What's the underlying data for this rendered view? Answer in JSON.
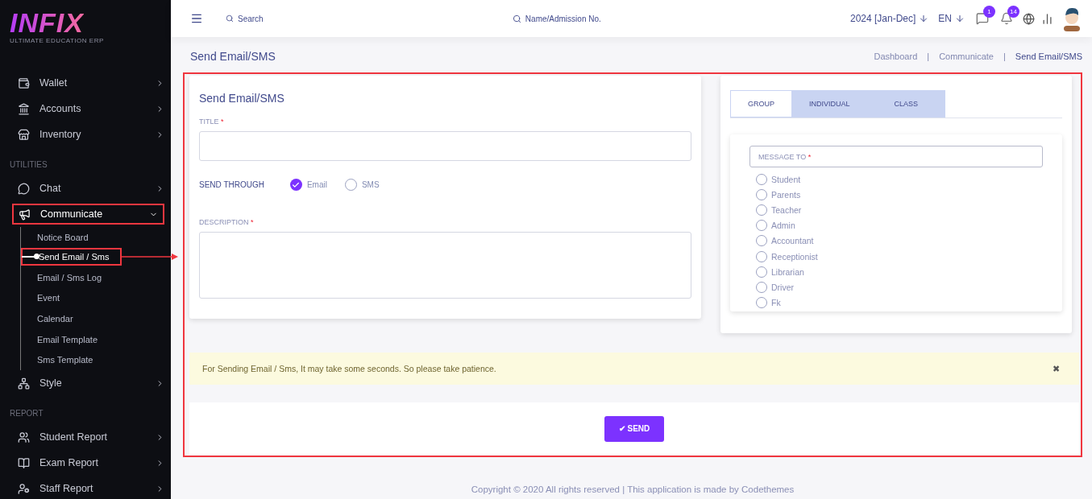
{
  "logo": {
    "word": "INFIX",
    "tagline": "ULTIMATE EDUCATION ERP"
  },
  "sidebar": {
    "groups": [
      {
        "items": [
          {
            "label": "Wallet",
            "expanded": false,
            "highlighted": false
          },
          {
            "label": "Accounts",
            "expanded": false,
            "highlighted": false
          },
          {
            "label": "Inventory",
            "expanded": false,
            "highlighted": false
          }
        ]
      },
      {
        "heading": "UTILITIES",
        "items": [
          {
            "label": "Chat",
            "expanded": false,
            "highlighted": false
          },
          {
            "label": "Communicate",
            "expanded": true,
            "highlighted": true,
            "children": [
              {
                "label": "Notice Board",
                "selected": false,
                "highlighted": false
              },
              {
                "label": "Send Email / Sms",
                "selected": true,
                "highlighted": true
              },
              {
                "label": "Email / Sms Log",
                "selected": false,
                "highlighted": false
              },
              {
                "label": "Event",
                "selected": false,
                "highlighted": false
              },
              {
                "label": "Calendar",
                "selected": false,
                "highlighted": false
              },
              {
                "label": "Email Template",
                "selected": false,
                "highlighted": false
              },
              {
                "label": "Sms Template",
                "selected": false,
                "highlighted": false
              }
            ]
          },
          {
            "label": "Style",
            "expanded": false,
            "highlighted": false
          }
        ]
      },
      {
        "heading": "REPORT",
        "items": [
          {
            "label": "Student Report",
            "expanded": false,
            "highlighted": false
          },
          {
            "label": "Exam Report",
            "expanded": false,
            "highlighted": false
          },
          {
            "label": "Staff Report",
            "expanded": false,
            "highlighted": false
          }
        ]
      }
    ]
  },
  "topbar": {
    "search_placeholder": "Search",
    "student_search_placeholder": "Name/Admission No.",
    "session": "2024 [Jan-Dec]",
    "language": "EN",
    "chat_badge": "1",
    "notification_badge": "14"
  },
  "page": {
    "title": "Send Email/SMS",
    "breadcrumb": [
      {
        "label": "Dashboard",
        "selected": false
      },
      {
        "label": "Communicate",
        "selected": false
      },
      {
        "label": "Send Email/SMS",
        "selected": true
      }
    ],
    "breadcrumb_separator": "|"
  },
  "form": {
    "heading": "Send Email/SMS",
    "title_label": "TITLE",
    "send_through_label": "SEND THROUGH",
    "send_through": [
      {
        "label": "Email",
        "selected": true
      },
      {
        "label": "SMS",
        "selected": false
      }
    ],
    "description_label": "DESCRIPTION",
    "required_mark": "*"
  },
  "recipients": {
    "tabs": [
      {
        "label": "GROUP",
        "selected": true
      },
      {
        "label": "INDIVIDUAL",
        "selected": false
      },
      {
        "label": "CLASS",
        "selected": false
      }
    ],
    "message_to_placeholder": "MESSAGE TO",
    "required_mark": "*",
    "options": [
      {
        "label": "Student",
        "checked": false
      },
      {
        "label": "Parents",
        "checked": false
      },
      {
        "label": "Teacher",
        "checked": false
      },
      {
        "label": "Admin",
        "checked": false
      },
      {
        "label": "Accountant",
        "checked": false
      },
      {
        "label": "Receptionist",
        "checked": false
      },
      {
        "label": "Librarian",
        "checked": false
      },
      {
        "label": "Driver",
        "checked": false
      },
      {
        "label": "Fk",
        "checked": false
      }
    ]
  },
  "alert": {
    "text": "For Sending Email / Sms, It may take some seconds. So please take patience.",
    "close": "✖"
  },
  "send_button": {
    "icon": "✔",
    "label": "SEND"
  },
  "content_highlighted": true,
  "footer": "Copyright © 2020 All rights reserved | This application is made by Codethemes"
}
